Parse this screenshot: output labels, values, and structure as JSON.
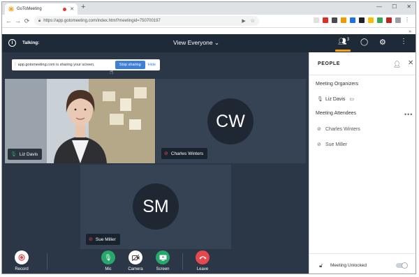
{
  "browser": {
    "tab_title": "GoToMeeting",
    "url": "https://app.gotomeeting.com/index.html?meetingid=750700197"
  },
  "header": {
    "talking_label": "Talking:",
    "view_label": "View Everyone",
    "people_count": "3"
  },
  "share_banner": {
    "message": "app.gotomeeting.com is sharing your screen.",
    "stop_label": "Stop sharing",
    "hide_label": "Hide"
  },
  "tiles": {
    "liz": {
      "name": "Liz Davis"
    },
    "cw": {
      "initials": "CW",
      "name": "Charles Winters"
    },
    "sm": {
      "initials": "SM",
      "name": "Sue Miller"
    }
  },
  "controls": {
    "record": "Record",
    "mic": "Mic",
    "camera": "Camera",
    "screen": "Screen",
    "leave": "Leave"
  },
  "panel": {
    "title": "PEOPLE",
    "organizers_label": "Meeting Organizers",
    "organizers": [
      "Liz Davis"
    ],
    "attendees_label": "Meeting Attendees",
    "attendees": [
      "Charles Winters",
      "Sue Miller"
    ],
    "lock_label": "Meeting Unlocked"
  },
  "colors": {
    "dark_bg": "#1e2a38",
    "stage_bg": "#2b3647",
    "accent_orange": "#f4a017",
    "share_blue": "#3e7fd8",
    "green": "#26a86a",
    "red": "#e5484d"
  },
  "icons": {
    "tab": "gotomeeting-logo-icon",
    "info": "info-icon",
    "people": "people-icon",
    "chat": "chat-icon",
    "settings": "gear-icon",
    "more": "more-vertical-icon",
    "mic": "mic-icon",
    "muted": "mic-muted-icon",
    "camera_off": "camera-off-icon",
    "screen": "screen-share-icon",
    "leave": "phone-hangup-icon",
    "record": "record-icon",
    "lock": "lock-icon"
  }
}
